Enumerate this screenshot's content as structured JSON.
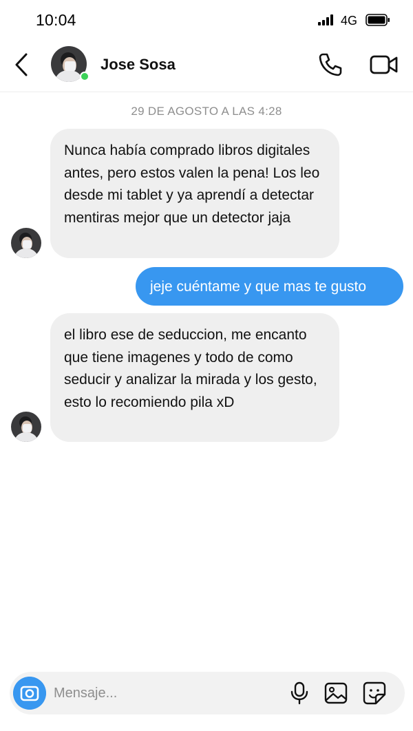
{
  "status_bar": {
    "time": "10:04",
    "network": "4G"
  },
  "header": {
    "contact_name": "Jose Sosa"
  },
  "conversation": {
    "timestamp": "29 DE AGOSTO A LAS 4:28",
    "messages": [
      {
        "from": "contact",
        "text": "Nunca había comprado libros digitales antes, pero estos valen la pena! Los leo desde mi tablet y ya aprendí a detectar mentiras mejor que un detector jaja"
      },
      {
        "from": "me",
        "text": "jeje cuéntame y que mas te gusto"
      },
      {
        "from": "contact",
        "text": "el libro ese de seduccion, me encanto que tiene imagenes y todo de como seducir y analizar la mirada y los gesto, esto lo recomiendo pila xD"
      }
    ]
  },
  "composer": {
    "placeholder": "Mensaje..."
  },
  "colors": {
    "accent": "#3897f0",
    "incoming_bubble": "#efefef",
    "online": "#3bd157"
  },
  "icons": [
    "back-arrow-icon",
    "phone-icon",
    "video-camera-icon",
    "camera-icon",
    "microphone-icon",
    "gallery-icon",
    "sticker-icon"
  ]
}
